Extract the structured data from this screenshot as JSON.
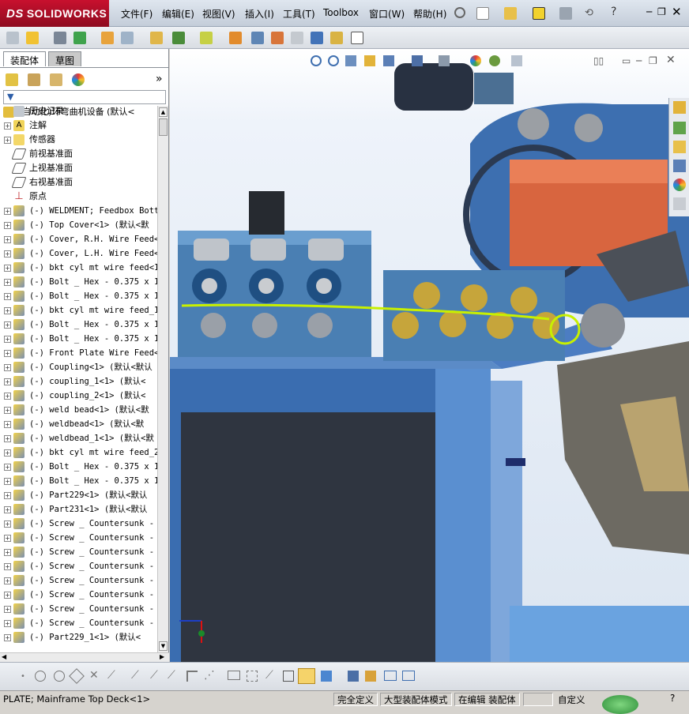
{
  "app": {
    "brand": "SOLIDWORKS",
    "brand_prefix": "DS"
  },
  "menu": [
    "文件(F)",
    "编辑(E)",
    "视图(V)",
    "插入(I)",
    "工具(T)",
    "Toolbox",
    "窗口(W)",
    "帮助(H)"
  ],
  "panel_tabs": [
    "装配体",
    "草图"
  ],
  "tree": {
    "root": "(自动化)环弯曲机设备  (默认<",
    "fixed_items": [
      "历史记录",
      "注解",
      "传感器",
      "前视基准面",
      "上视基准面",
      "右视基准面",
      "原点"
    ],
    "components": [
      "(-) WELDMENT; Feedbox Bott",
      "(-) Top Cover<1> (默认<默",
      "(-) Cover, R.H. Wire Feed<",
      "(-) Cover, L.H. Wire Feed<",
      "(-) bkt cyl mt wire feed<1",
      "(-) Bolt _ Hex - 0.375 x 1",
      "(-) Bolt _ Hex - 0.375 x 1",
      "(-) bkt cyl mt wire feed_1",
      "(-) Bolt _ Hex - 0.375 x 1",
      "(-) Bolt _ Hex - 0.375 x 1",
      "(-) Front Plate Wire Feed<",
      "(-) Coupling<1> (默认<默认",
      "(-) coupling_1<1> (默认<",
      "(-) coupling_2<1> (默认<",
      "(-) weld bead<1> (默认<默",
      "(-) weldbead<1> (默认<默",
      "(-) weldbead_1<1> (默认<默",
      "(-) bkt cyl mt wire feed_2",
      "(-) Bolt _ Hex - 0.375 x 1",
      "(-) Bolt _ Hex - 0.375 x 1",
      "(-) Part229<1> (默认<默认",
      "(-) Part231<1> (默认<默认",
      "(-) Screw _ Countersunk -",
      "(-) Screw _ Countersunk -",
      "(-) Screw _ Countersunk -",
      "(-) Screw _ Countersunk -",
      "(-) Screw _ Countersunk -",
      "(-) Screw _ Countersunk -",
      "(-) Screw _ Countersunk -",
      "(-) Screw _ Countersunk -",
      "(-) Part229_1<1> (默认<"
    ]
  },
  "status": {
    "selection": "PLATE; Mainframe Top Deck<1>",
    "constraint": "完全定义",
    "mode": "大型装配体模式",
    "editing": "在编辑 装配体",
    "units": "自定义"
  },
  "colors": {
    "accent": "#c8102e",
    "machine_blue": "#3f6fa8",
    "frame_blue": "#3a6db0",
    "wire": "#c8f000",
    "copper": "#d8653f"
  }
}
